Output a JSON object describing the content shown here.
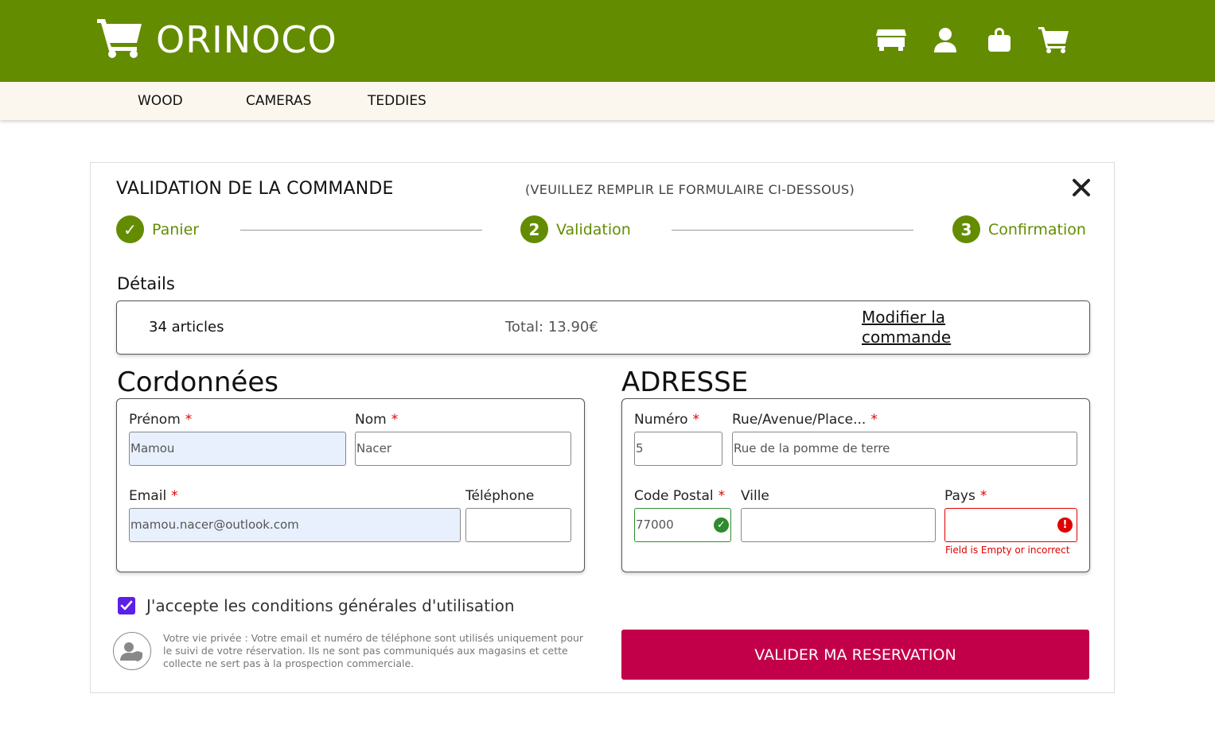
{
  "header": {
    "brand": "ORINOCO",
    "icons": [
      "store-icon",
      "user-icon",
      "bag-icon",
      "cart-icon"
    ],
    "bg_color": "#648c00"
  },
  "categories": [
    "WOOD",
    "CAMERAS",
    "TEDDIES"
  ],
  "panel": {
    "title": "VALIDATION DE LA COMMANDE",
    "subtitle": "(VEUILLEZ REMPLIR LE FORMULAIRE CI-DESSOUS)"
  },
  "steps": [
    {
      "label": "Panier",
      "marker": "✓"
    },
    {
      "label": "Validation",
      "marker": "2"
    },
    {
      "label": "Confirmation",
      "marker": "3"
    }
  ],
  "details": {
    "label": "Détails",
    "articles": "34 articles",
    "total": "Total: 13.90€",
    "modify": "Modifier la commande"
  },
  "coordonnees": {
    "title": "Cordonnées",
    "prenom_label": "Prénom",
    "prenom_value": "Mamou",
    "nom_label": "Nom",
    "nom_value": "Nacer",
    "email_label": "Email",
    "email_value": "mamou.nacer@outlook.com",
    "telephone_label": "Téléphone",
    "telephone_value": ""
  },
  "adresse": {
    "title": "ADRESSE",
    "numero_label": "Numéro",
    "numero_value": "5",
    "rue_label": "Rue/Avenue/Place...",
    "rue_value": "Rue de la pomme de terre",
    "cp_label": "Code Postal",
    "cp_value": "77000",
    "ville_label": "Ville",
    "ville_value": "",
    "pays_label": "Pays",
    "pays_value": "",
    "pays_error": "Field is Empty or incorrect"
  },
  "required_mark": "*",
  "cgu": {
    "label": "J'accepte les conditions générales d'utilisation",
    "checked": true
  },
  "privacy": "Votre vie privée : Votre email et numéro de téléphone sont utilisés uniquement pour le suivi de votre réservation. Ils ne sont pas communiqués aux magasins et cette collecte ne sert pas à la prospection commerciale.",
  "submit_label": "VALIDER MA RESERVATION",
  "colors": {
    "accent": "#648c00",
    "submit": "#c2004a",
    "error": "#e00000",
    "valid": "#2e8b2e",
    "checkbox": "#5b1fe8"
  }
}
